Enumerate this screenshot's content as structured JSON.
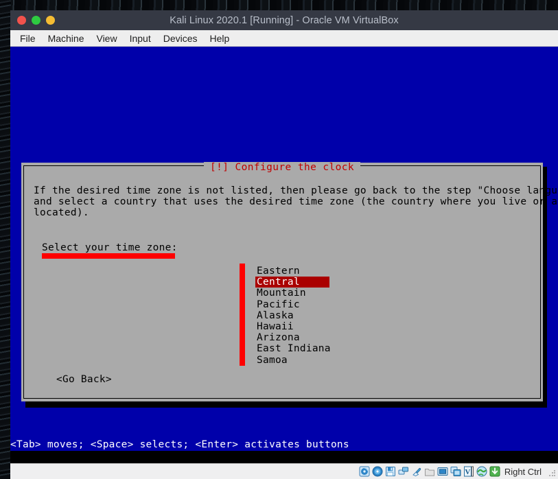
{
  "window": {
    "title": "Kali Linux 2020.1 [Running] - Oracle VM VirtualBox",
    "controls": [
      {
        "name": "close",
        "color": "#f2524c"
      },
      {
        "name": "minimize",
        "color": "#2ecb41"
      },
      {
        "name": "maximize",
        "color": "#f4bc33"
      }
    ]
  },
  "menubar": {
    "items": [
      {
        "label": "File"
      },
      {
        "label": "Machine"
      },
      {
        "label": "View"
      },
      {
        "label": "Input"
      },
      {
        "label": "Devices"
      },
      {
        "label": "Help"
      }
    ]
  },
  "installer": {
    "background_color": "#0000aa",
    "dialog": {
      "title": "[!] Configure the clock",
      "title_color": "#c00000",
      "background_color": "#aaaaaa",
      "paragraph": [
        "If the desired time zone is not listed, then please go back to the step \"Choose language\"",
        "and select a country that uses the desired time zone (the country where you live or are",
        "located)."
      ],
      "select_label": "Select your time zone:",
      "timezones": [
        {
          "label": "Eastern",
          "selected": false
        },
        {
          "label": "Central",
          "selected": true
        },
        {
          "label": "Mountain",
          "selected": false
        },
        {
          "label": "Pacific",
          "selected": false
        },
        {
          "label": "Alaska",
          "selected": false
        },
        {
          "label": "Hawaii",
          "selected": false
        },
        {
          "label": "Arizona",
          "selected": false
        },
        {
          "label": "East Indiana",
          "selected": false
        },
        {
          "label": "Samoa",
          "selected": false
        }
      ],
      "selected_timezone": "Central",
      "selection_color": "#aa0000",
      "scrollbar_color": "#ff0000",
      "go_back_button": "<Go Back>"
    },
    "hint_line": "<Tab> moves; <Space> selects; <Enter> activates buttons"
  },
  "statusbar": {
    "icons": [
      {
        "name": "hard-disk-icon"
      },
      {
        "name": "optical-disk-icon"
      },
      {
        "name": "floppy-disk-icon"
      },
      {
        "name": "network-icon"
      },
      {
        "name": "usb-icon"
      },
      {
        "name": "shared-folder-icon"
      },
      {
        "name": "display-icon"
      },
      {
        "name": "recording-icon"
      },
      {
        "name": "virtualbox-logo-icon"
      },
      {
        "name": "mouse-integration-icon"
      },
      {
        "name": "host-key-icon"
      }
    ],
    "host_key": "Right Ctrl"
  }
}
